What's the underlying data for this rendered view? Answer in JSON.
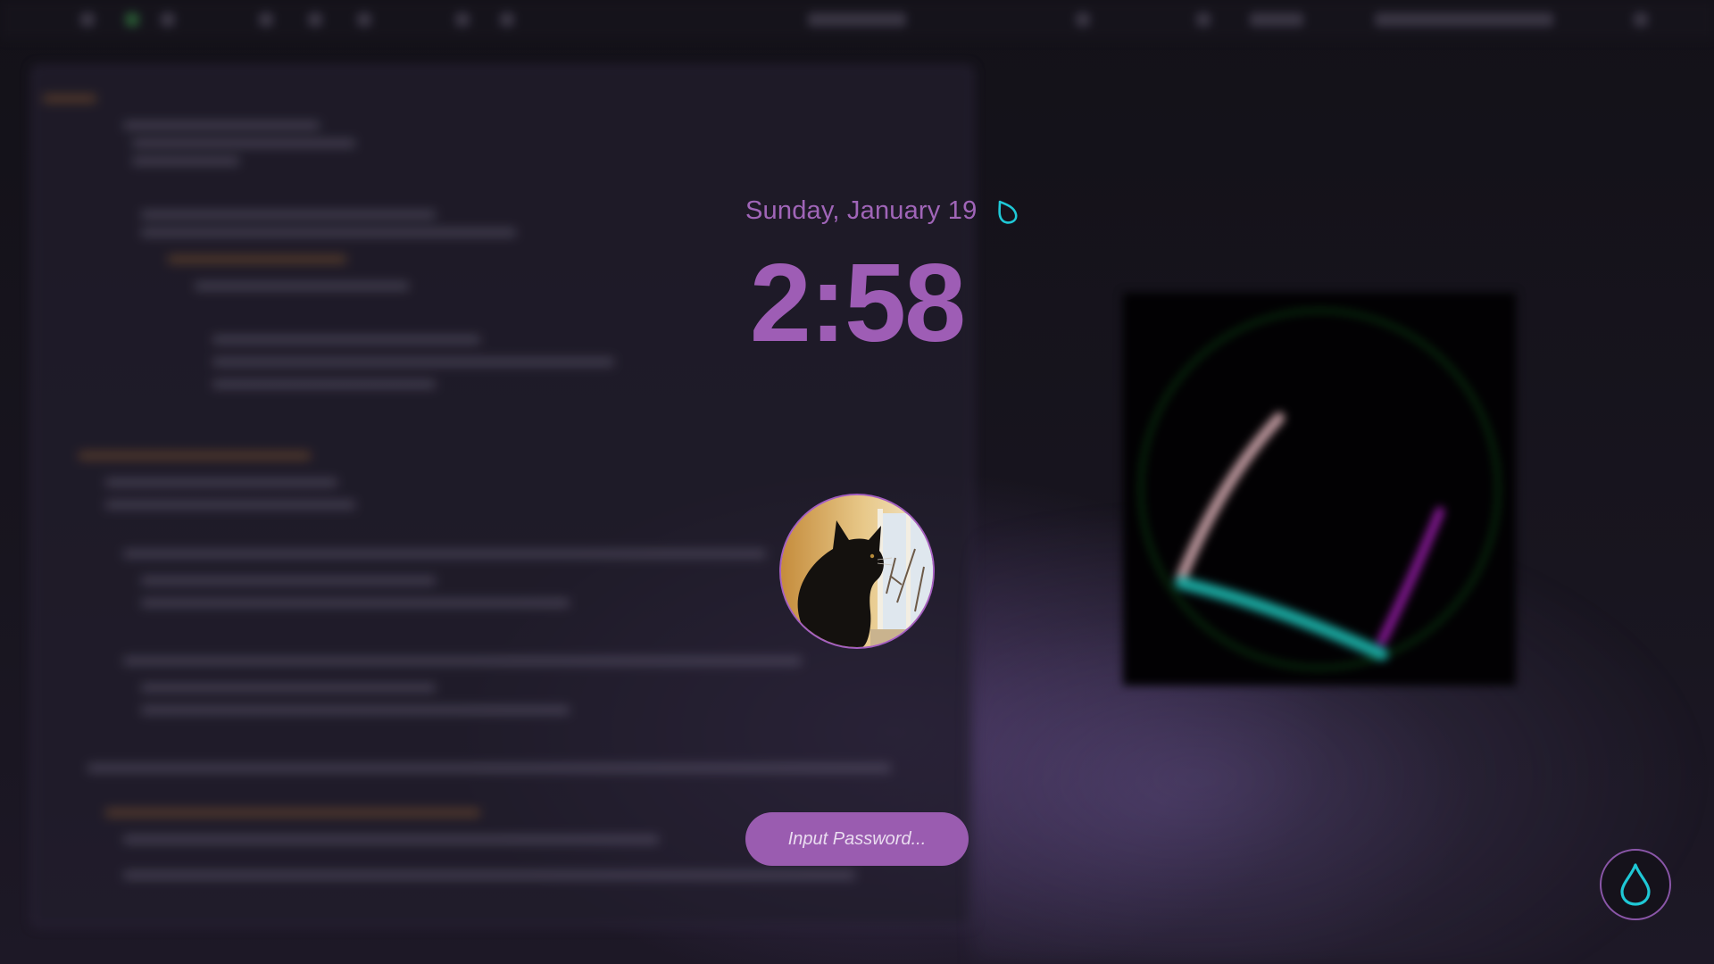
{
  "lockscreen": {
    "date": "Sunday, January 19",
    "time": "2:58",
    "password_placeholder": "Input Password..."
  },
  "icons": {
    "status": "droplet-outline-icon",
    "launcher": "droplet-icon",
    "avatar": "cat-avatar"
  },
  "colors": {
    "accent_purple": "#9e5db5",
    "field_purple": "#9a5cb0",
    "icon_cyan": "#1fc8d6",
    "background": "#141219"
  }
}
